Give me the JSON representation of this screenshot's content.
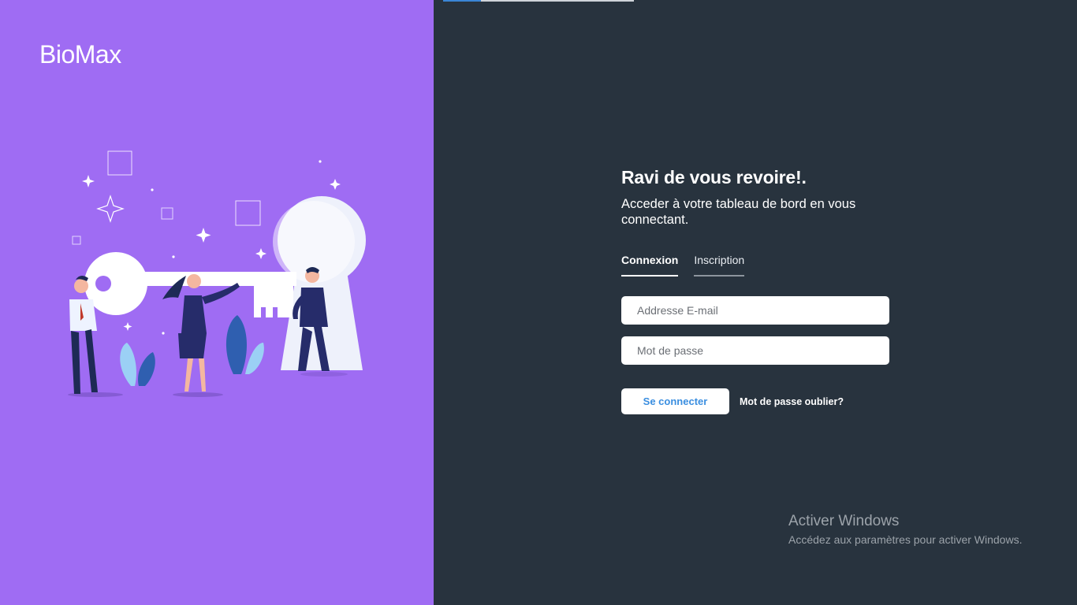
{
  "brand": {
    "name": "BioMax"
  },
  "colors": {
    "left_panel": "#9f6cf3",
    "right_panel": "#28333e",
    "button_text": "#3a8ee0",
    "progress": "#3a86d6"
  },
  "page_progress": {
    "fraction": 0.2
  },
  "login": {
    "title": "Ravi de vous revoire!.",
    "subtitle": "Acceder à votre tableau de bord en vous connectant.",
    "tabs": [
      {
        "label": "Connexion",
        "active": true
      },
      {
        "label": "Inscription",
        "active": false
      }
    ],
    "email": {
      "placeholder": "Addresse E-mail",
      "value": ""
    },
    "password": {
      "placeholder": "Mot de passe",
      "value": ""
    },
    "submit_label": "Se connecter",
    "forgot_label": "Mot de passe oublier?"
  },
  "illustration": {
    "icon": "people-with-key-illustration"
  },
  "windows_watermark": {
    "title": "Activer Windows",
    "subtitle": "Accédez aux paramètres pour activer Windows."
  }
}
